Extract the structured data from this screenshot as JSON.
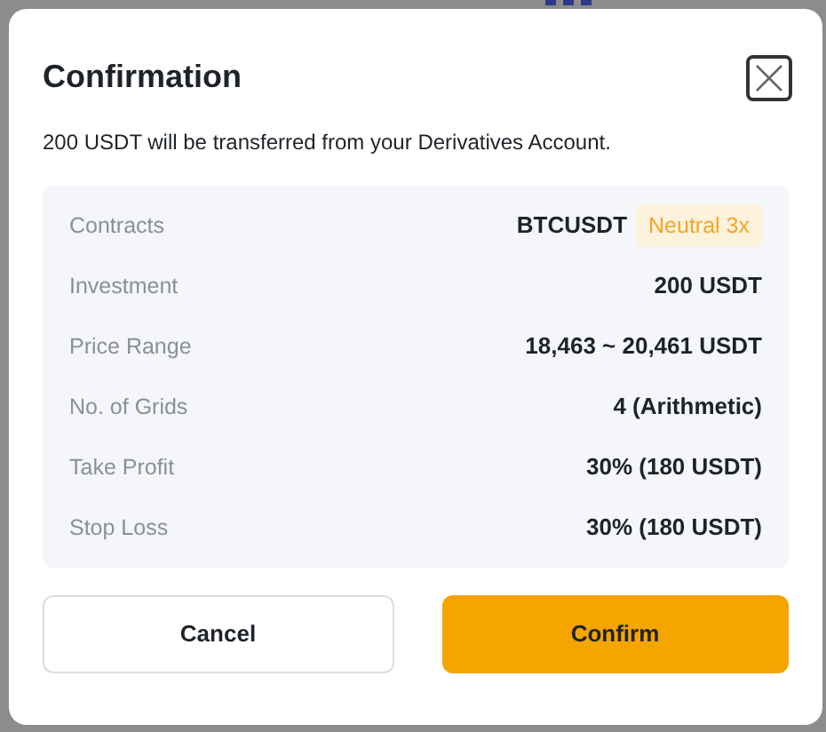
{
  "dialog": {
    "title": "Confirmation",
    "message": "200 USDT will be transferred from your Derivatives Account.",
    "rows": [
      {
        "label": "Contracts",
        "value": "BTCUSDT",
        "tag": "Neutral 3x"
      },
      {
        "label": "Investment",
        "value": "200 USDT"
      },
      {
        "label": "Price Range",
        "value": "18,463 ~ 20,461 USDT"
      },
      {
        "label": "No. of Grids",
        "value": "4 (Arithmetic)"
      },
      {
        "label": "Take Profit",
        "value": "30% (180 USDT)"
      },
      {
        "label": "Stop Loss",
        "value": "30% (180 USDT)"
      }
    ],
    "buttons": [
      {
        "label": "Cancel",
        "kind": "secondary"
      },
      {
        "label": "Confirm",
        "kind": "primary"
      }
    ]
  }
}
